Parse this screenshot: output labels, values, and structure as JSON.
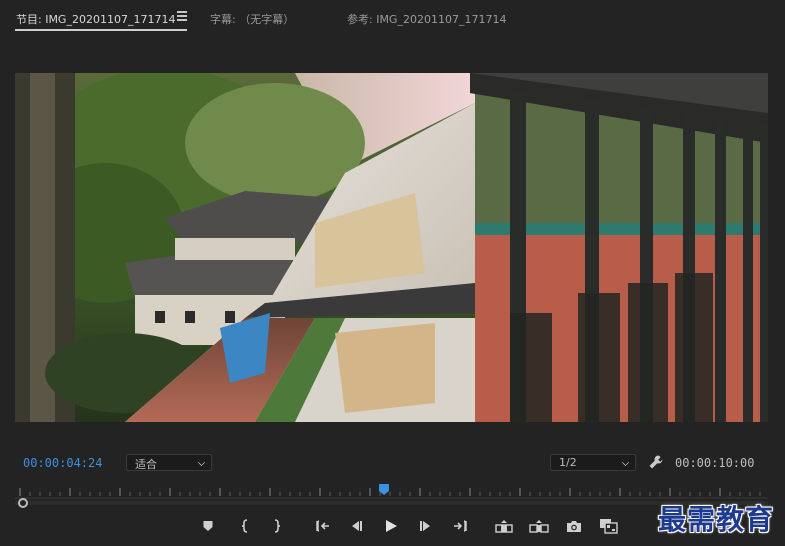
{
  "tabs": [
    {
      "label": "节目: IMG_20201107_171714",
      "active": true
    },
    {
      "label": "字幕: （无字幕）",
      "active": false
    },
    {
      "label": "参考: IMG_20201107_171714",
      "active": false
    }
  ],
  "icons": {
    "panel_menu": "hamburger-menu-icon",
    "settings": "wrench-icon"
  },
  "player": {
    "current_time": "00:00:04:24",
    "duration": "00:00:10:00",
    "zoom": "适合",
    "resolution": "1/2",
    "playhead_fraction": 0.49
  },
  "transport": [
    {
      "name": "add-marker",
      "icon": "marker-icon"
    },
    {
      "name": "mark-in",
      "icon": "mark-in-icon"
    },
    {
      "name": "mark-out",
      "icon": "mark-out-icon"
    },
    {
      "name": "go-to-in",
      "icon": "go-to-in-icon"
    },
    {
      "name": "step-back",
      "icon": "step-back-icon"
    },
    {
      "name": "play",
      "icon": "play-icon"
    },
    {
      "name": "step-forward",
      "icon": "step-forward-icon"
    },
    {
      "name": "go-to-out",
      "icon": "go-to-out-icon"
    },
    {
      "name": "lift",
      "icon": "lift-icon"
    },
    {
      "name": "extract",
      "icon": "extract-icon"
    },
    {
      "name": "export-frame",
      "icon": "camera-icon"
    },
    {
      "name": "compare-view",
      "icon": "compare-view-icon"
    }
  ],
  "colors": {
    "accent": "#3d8fe0",
    "watermark": "#1d3a8f"
  },
  "watermark": "最需教育"
}
